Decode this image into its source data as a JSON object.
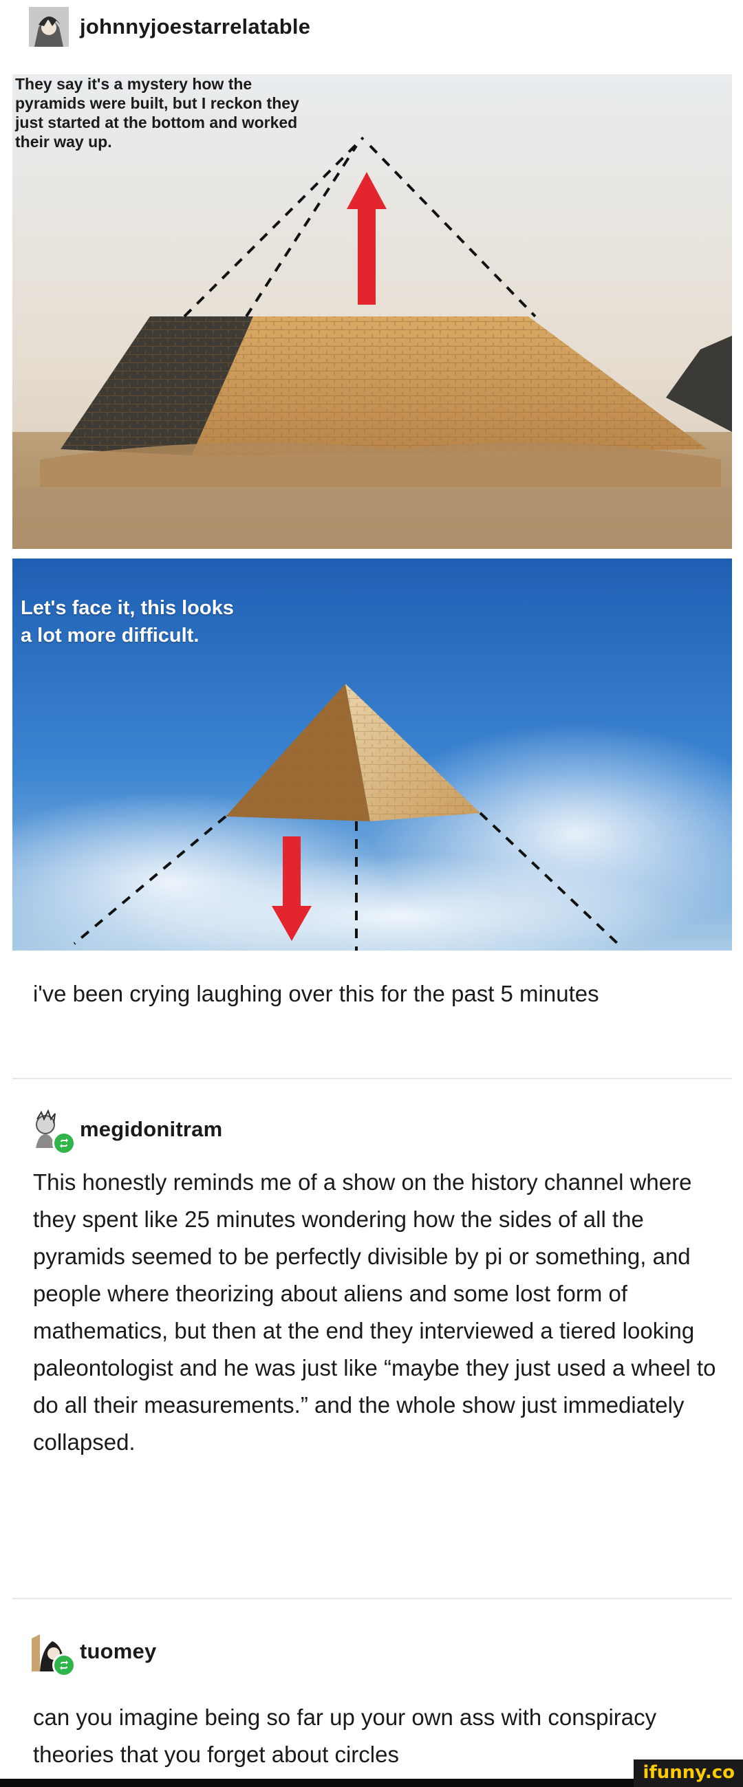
{
  "post": {
    "author": "johnnyjoestarrelatable",
    "image_top_caption": "They say it's a mystery how the pyramids were built, but I reckon they just started at the bottom and worked their way up.",
    "image_bottom_caption": "Let's face it, this looks a lot more difficult.",
    "op_text": "i've been crying laughing over this for the past 5 minutes"
  },
  "reblogs": [
    {
      "username": "megidonitram",
      "text": "This honestly reminds me of a show on the history channel where they spent like 25 minutes wondering how the sides of all the pyramids seemed to be perfectly divisible by pi or something, and people where theorizing about aliens and some lost form of mathematics, but then at the end they interviewed a tiered looking paleontologist and he was just like “maybe they just used a wheel to do all their measurements.” and the whole show just immediately collapsed."
    },
    {
      "username": "tuomey",
      "text": "can you imagine being so far up your own ass with conspiracy theories that you forget about circles"
    }
  ],
  "watermark": "ifunny.co",
  "colors": {
    "arrow_red": "#e3262e",
    "sky_top": "#2f6fbf",
    "sand": "#c9a064",
    "reblog_green": "#2fb549"
  }
}
